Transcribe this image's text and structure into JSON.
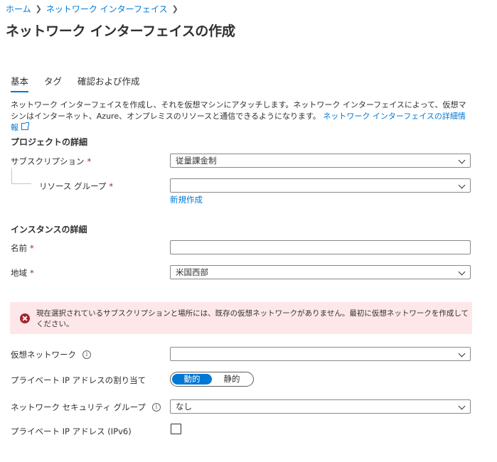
{
  "breadcrumb": {
    "home": "ホーム",
    "current": "ネットワーク インターフェイス"
  },
  "page": {
    "title": "ネットワーク インターフェイスの作成",
    "more": "···"
  },
  "tabs": [
    {
      "label": "基本"
    },
    {
      "label": "タグ"
    },
    {
      "label": "確認および作成"
    }
  ],
  "description": {
    "text": "ネットワーク インターフェイスを作成し、それを仮想マシンにアタッチします。ネットワーク インターフェイスによって、仮想マシンはインターネット、Azure、オンプレミスのリソースと通信できるようになります。",
    "link": "ネットワーク インターフェイスの詳細情報"
  },
  "project": {
    "title": "プロジェクトの詳細",
    "subscription": {
      "label": "サブスクリプション",
      "value": "従量課金制"
    },
    "resource_group": {
      "label": "リソース グループ",
      "value": "",
      "create_new": "新規作成"
    }
  },
  "instance": {
    "title": "インスタンスの詳細",
    "name": {
      "label": "名前",
      "value": ""
    },
    "region": {
      "label": "地域",
      "value": "米国西部"
    }
  },
  "error": {
    "message": "現在選択されているサブスクリプションと場所には、既存の仮想ネットワークがありません。最初に仮想ネットワークを作成してください。"
  },
  "network": {
    "vnet": {
      "label": "仮想ネットワーク",
      "value": ""
    },
    "private_ip": {
      "label": "プライベート IP アドレスの割り当て",
      "options": [
        "動的",
        "静的"
      ],
      "selected": "動的"
    },
    "nsg": {
      "label": "ネットワーク セキュリティ グループ",
      "value": "なし"
    },
    "ipv6": {
      "label": "プライベート IP アドレス (IPv6)",
      "checked": false
    }
  },
  "common": {
    "required_mark": "*",
    "info_glyph": "i"
  },
  "colors": {
    "accent": "#0078d4",
    "required": "#a4262c",
    "error_bg": "#fde7e9"
  }
}
